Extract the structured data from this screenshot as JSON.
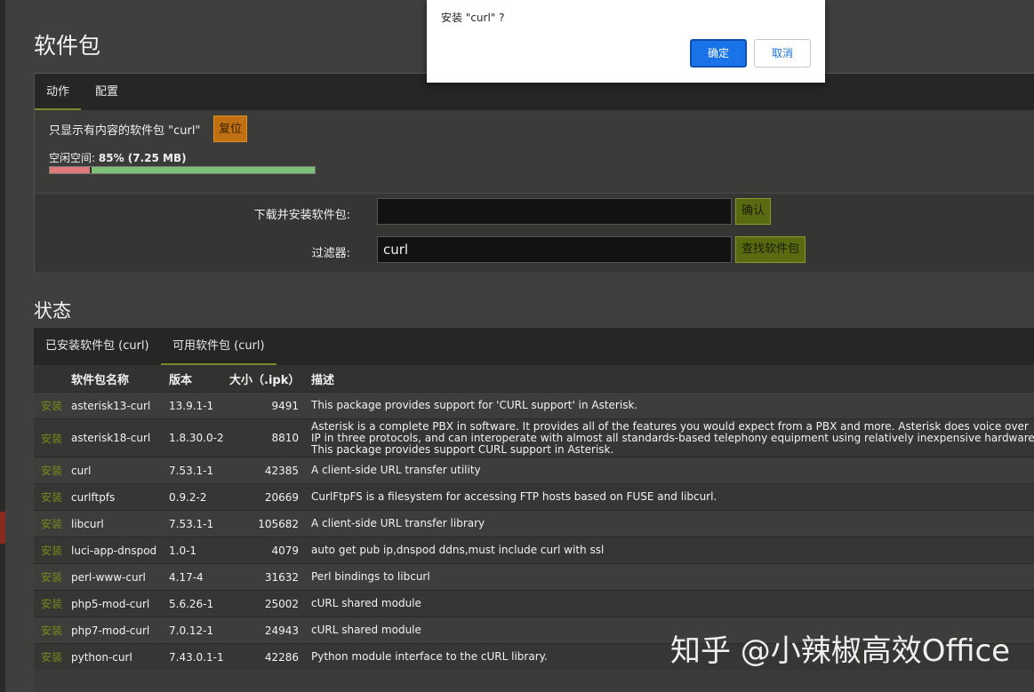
{
  "page_title": "软件包",
  "action_tabs": [
    "动作",
    "配置"
  ],
  "filter": {
    "text": "只显示有内容的软件包 \"curl\"",
    "reset_label": "复位"
  },
  "free_space": {
    "label": "空闲空间:",
    "value": "85% (7.25 MB)",
    "free_fraction": 0.85
  },
  "download": {
    "label": "下载并安装软件包:",
    "value": "",
    "button": "确认"
  },
  "filter_input": {
    "label": "过滤器:",
    "value": "curl",
    "button": "查找软件包"
  },
  "status_title": "状态",
  "status_tabs": [
    "已安装软件包 (curl)",
    "可用软件包 (curl)"
  ],
  "table": {
    "headers": [
      "",
      "软件包名称",
      "版本",
      "大小（.ipk）",
      "描述"
    ],
    "install_label": "安装",
    "rows": [
      {
        "name": "asterisk13-curl",
        "version": "13.9.1-1",
        "size": "9491",
        "desc": "This package provides support for 'CURL support' in Asterisk."
      },
      {
        "name": "asterisk18-curl",
        "version": "1.8.30.0-2",
        "size": "8810",
        "desc": "Asterisk is a complete PBX in software. It provides all of the features you would expect from a PBX and more. Asterisk does voice over IP in three protocols, and can interoperate with almost all standards-based telephony equipment using relatively inexpensive hardware. This package provides support CURL support in Asterisk."
      },
      {
        "name": "curl",
        "version": "7.53.1-1",
        "size": "42385",
        "desc": "A client-side URL transfer utility"
      },
      {
        "name": "curlftpfs",
        "version": "0.9.2-2",
        "size": "20669",
        "desc": "CurlFtpFS is a filesystem for accessing FTP hosts based on FUSE and libcurl."
      },
      {
        "name": "libcurl",
        "version": "7.53.1-1",
        "size": "105682",
        "desc": "A client-side URL transfer library"
      },
      {
        "name": "luci-app-dnspod",
        "version": "1.0-1",
        "size": "4079",
        "desc": "auto get pub ip,dnspod ddns,must include curl with ssl"
      },
      {
        "name": "perl-www-curl",
        "version": "4.17-4",
        "size": "31632",
        "desc": "Perl bindings to libcurl"
      },
      {
        "name": "php5-mod-curl",
        "version": "5.6.26-1",
        "size": "25002",
        "desc": "cURL shared module"
      },
      {
        "name": "php7-mod-curl",
        "version": "7.0.12-1",
        "size": "24943",
        "desc": "cURL shared module"
      },
      {
        "name": "python-curl",
        "version": "7.43.0.1-1",
        "size": "42286",
        "desc": "Python module interface to the cURL library."
      }
    ]
  },
  "dialog": {
    "message": "安装 \"curl\" ?",
    "ok": "确定",
    "cancel": "取消"
  },
  "watermark": "知乎 @小辣椒高效Office"
}
